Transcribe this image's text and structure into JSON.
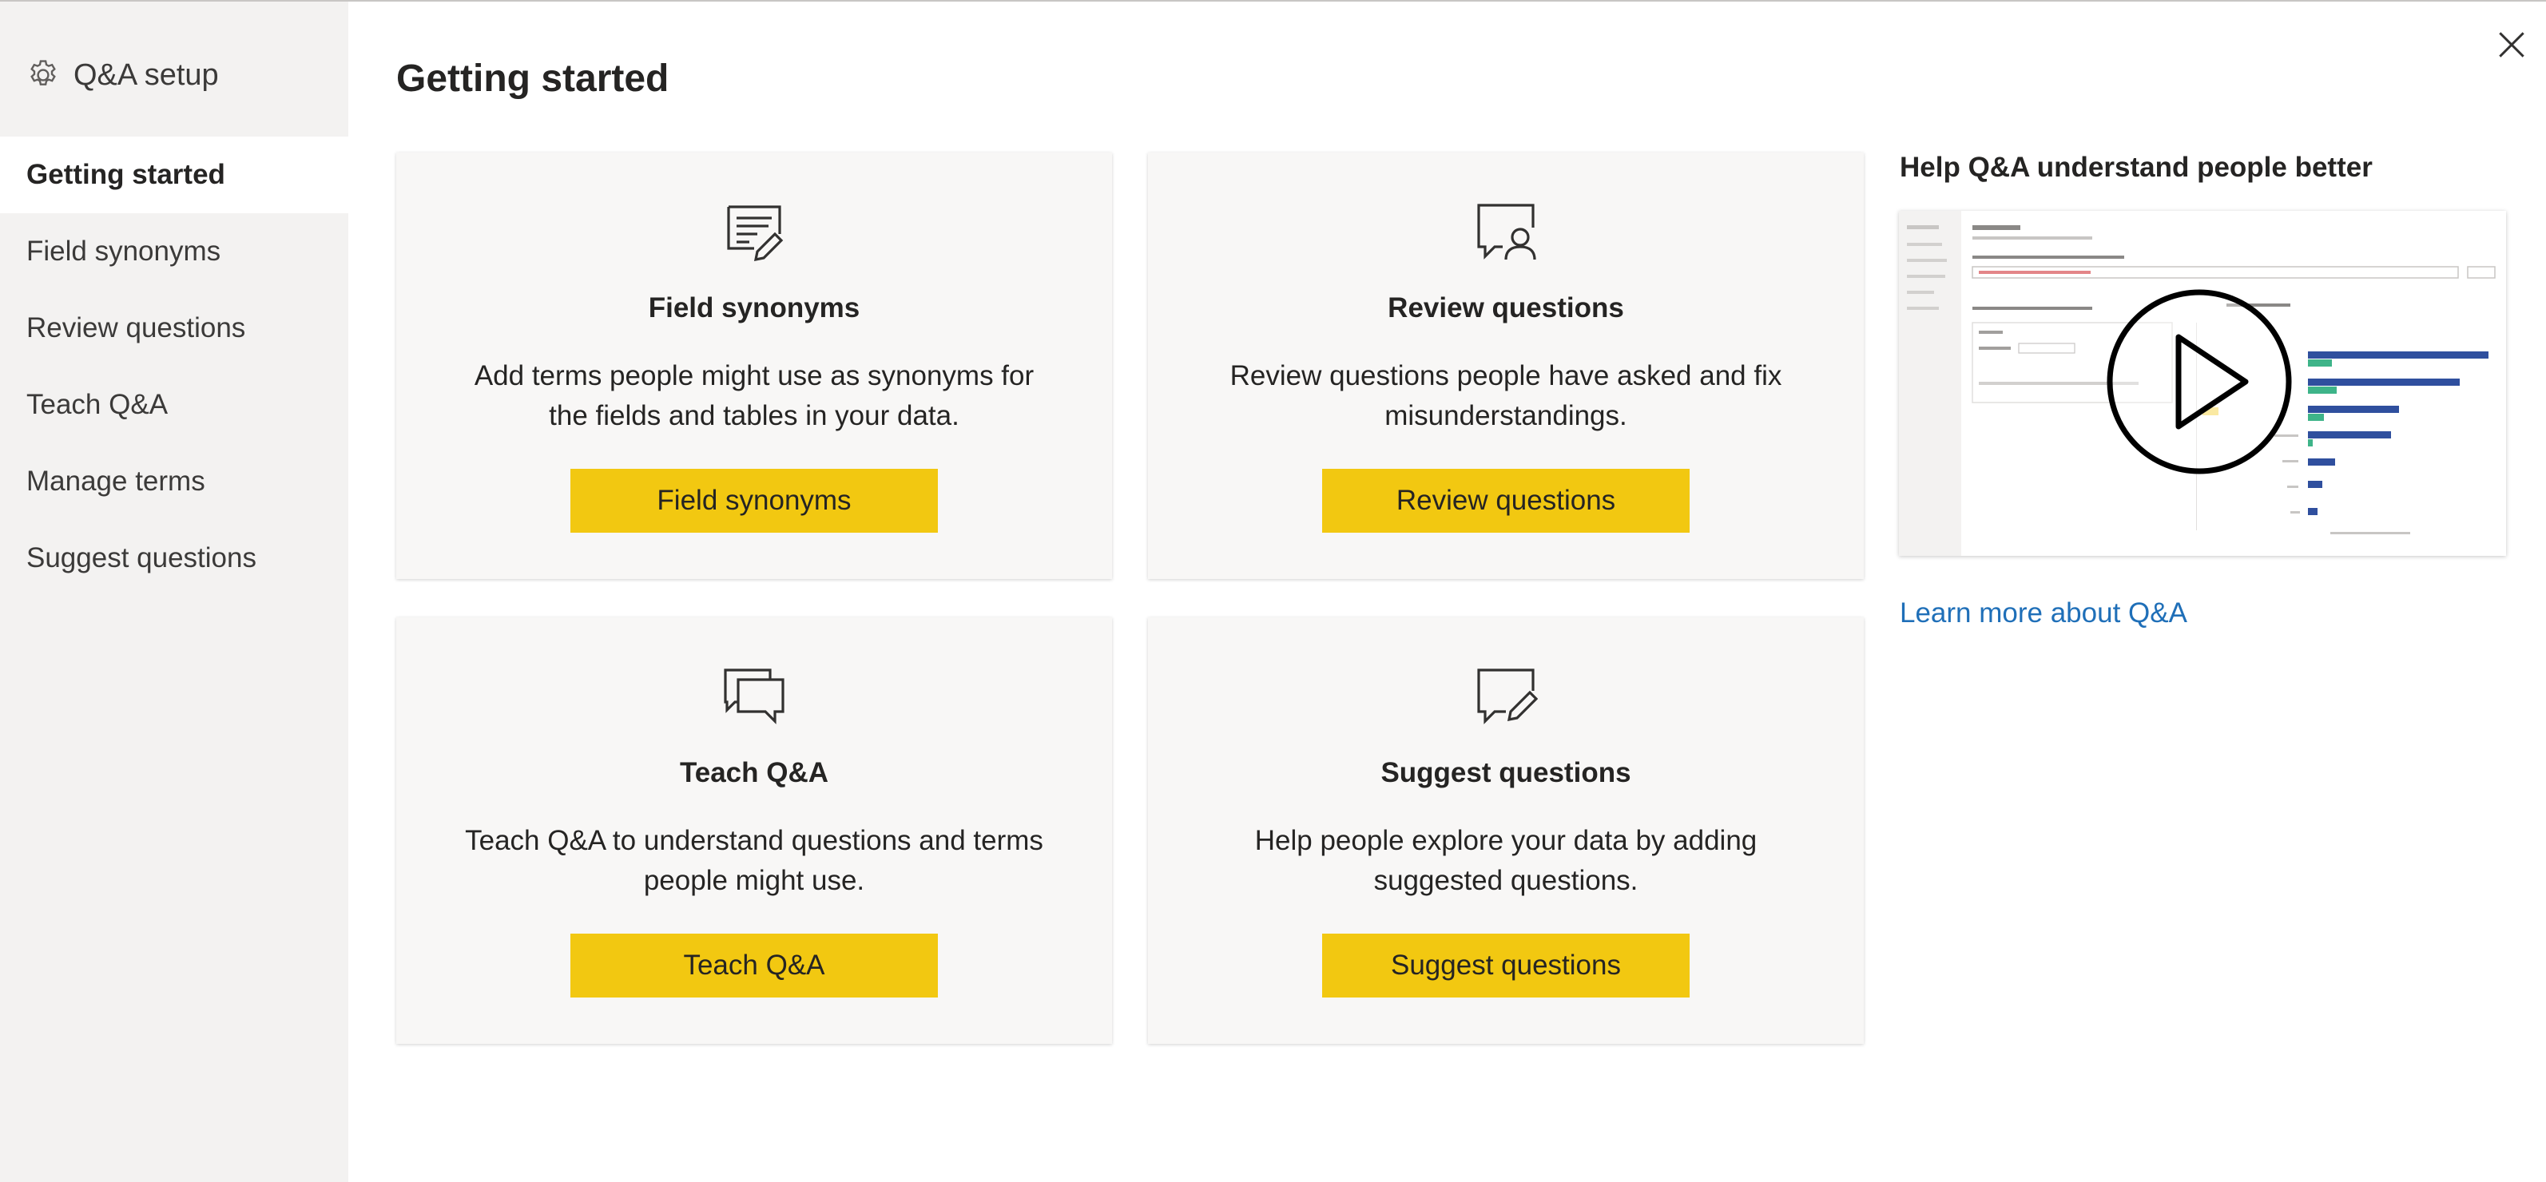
{
  "sidebar": {
    "title": "Q&A setup",
    "items": [
      {
        "label": "Getting started",
        "active": true
      },
      {
        "label": "Field synonyms",
        "active": false
      },
      {
        "label": "Review questions",
        "active": false
      },
      {
        "label": "Teach Q&A",
        "active": false
      },
      {
        "label": "Manage terms",
        "active": false
      },
      {
        "label": "Suggest questions",
        "active": false
      }
    ]
  },
  "main": {
    "title": "Getting started",
    "cards": [
      {
        "icon": "document-edit-icon",
        "title": "Field synonyms",
        "description": "Add terms people might use as synonyms for the fields and tables in your data.",
        "button": "Field synonyms"
      },
      {
        "icon": "chat-person-icon",
        "title": "Review questions",
        "description": "Review questions people have asked and fix misunderstandings.",
        "button": "Review questions"
      },
      {
        "icon": "conversation-icon",
        "title": "Teach Q&A",
        "description": "Teach Q&A to understand questions and terms people might use.",
        "button": "Teach Q&A"
      },
      {
        "icon": "chat-pencil-icon",
        "title": "Suggest questions",
        "description": "Help people explore your data by adding suggested questions.",
        "button": "Suggest questions"
      }
    ]
  },
  "aside": {
    "title": "Help Q&A understand people better",
    "video_label": "play-icon",
    "link": "Learn more about Q&A"
  },
  "colors": {
    "accent_button": "#f2c811",
    "link": "#1f6fb8",
    "sidebar_bg": "#f3f2f1",
    "card_bg": "#f8f7f6"
  }
}
